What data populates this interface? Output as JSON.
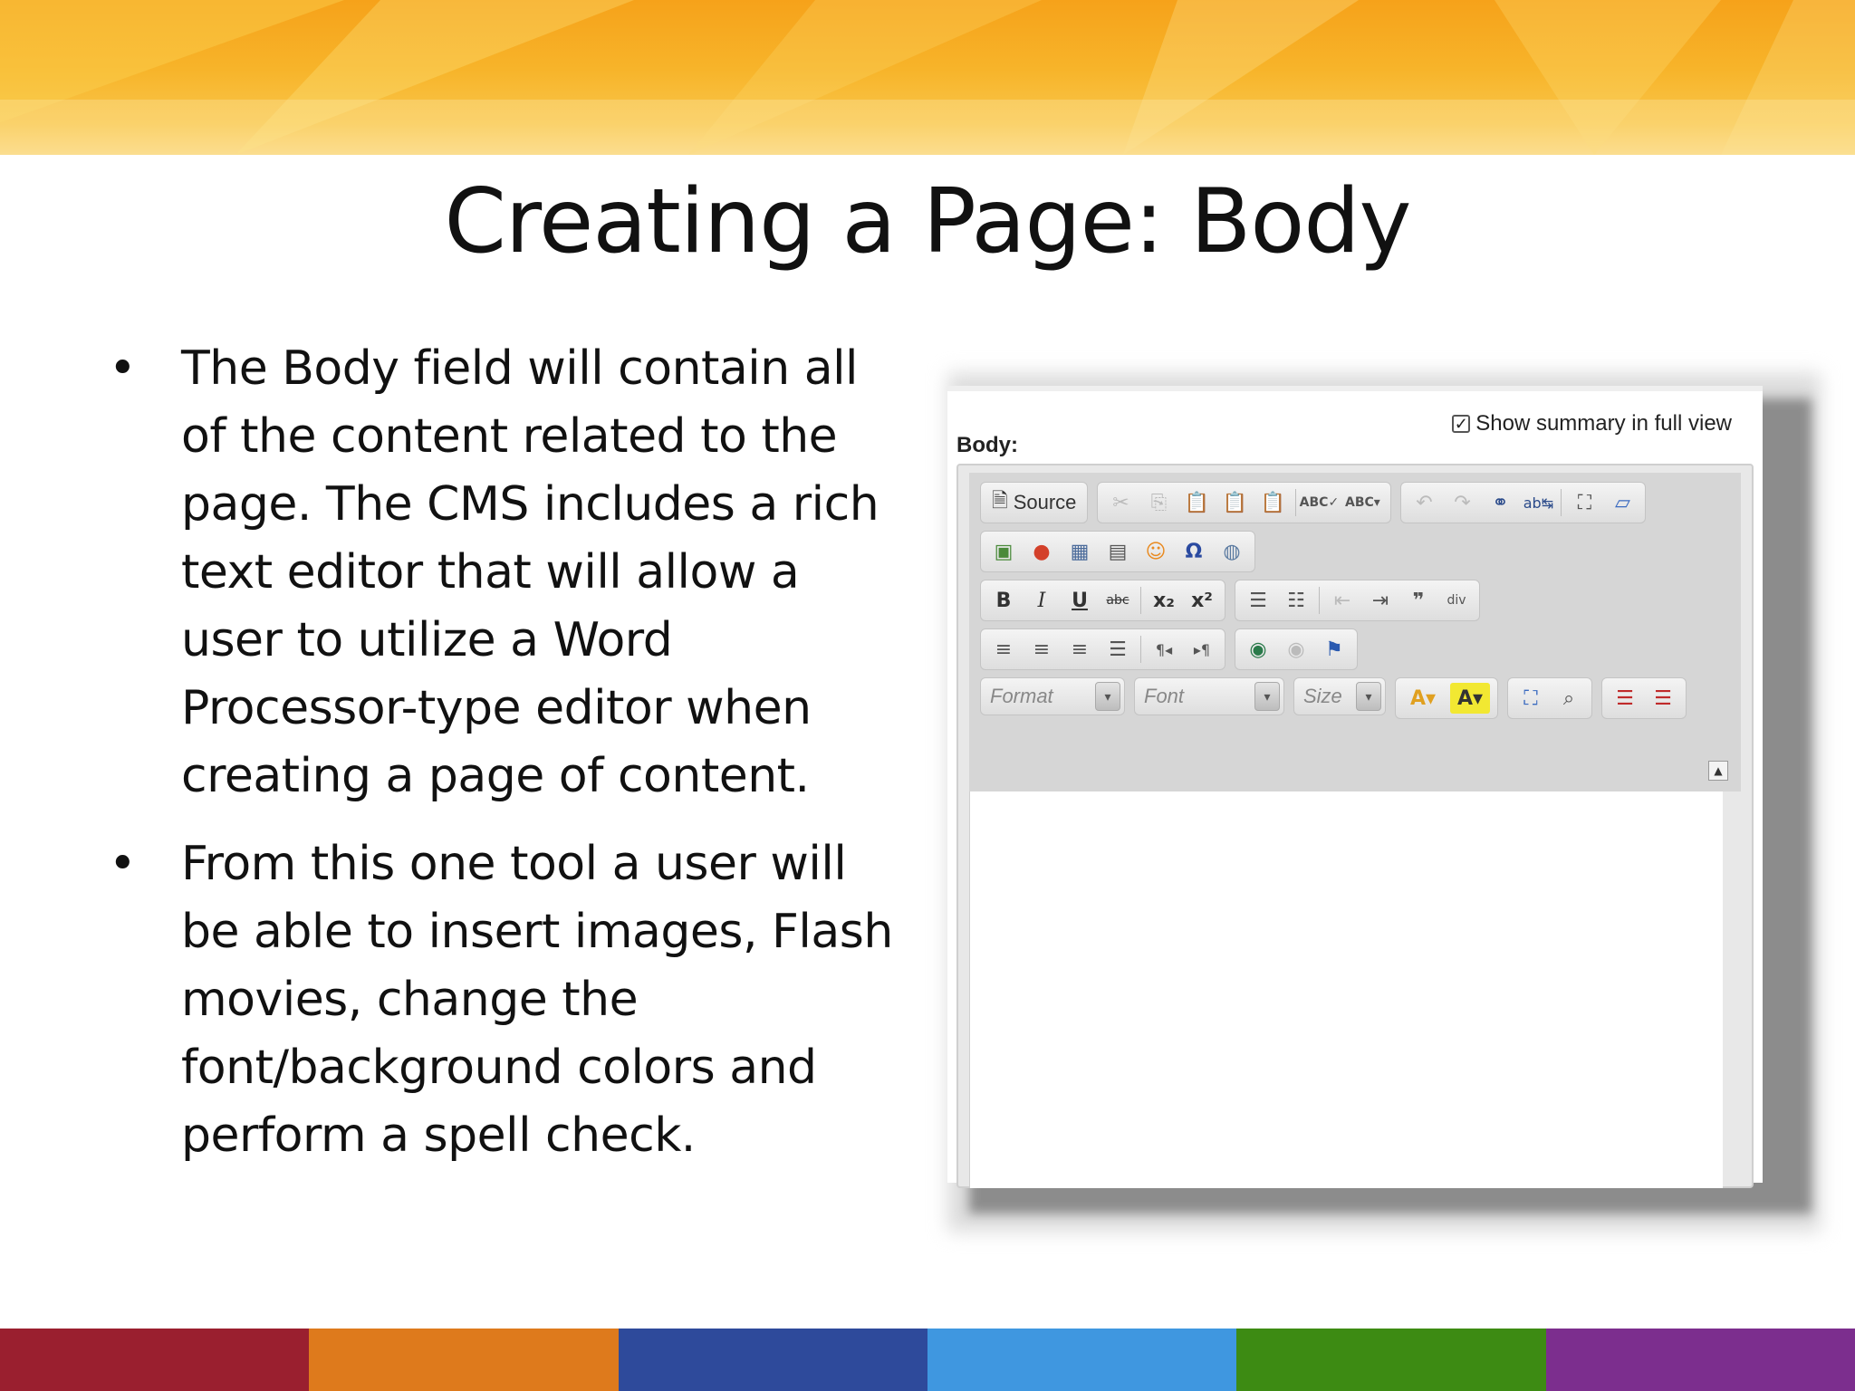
{
  "slide": {
    "title": "Creating a Page: Body",
    "bullets": [
      "The Body field will contain all of the content related to the page. The CMS includes a rich text editor that will allow a user to utilize a Word Processor-type editor when creating a page of content.",
      "From this one tool a user will be able to insert images, Flash movies, change the font/background colors and perform a spell check."
    ],
    "bullet_glyph": "•"
  },
  "editor_screenshot": {
    "summary_label": "Show summary in full view",
    "summary_checked": true,
    "body_label": "Body:",
    "toolbar": {
      "source_label": "Source",
      "format_placeholder": "Format",
      "font_placeholder": "Font",
      "size_placeholder": "Size",
      "icons": {
        "source": "document-icon",
        "cut": "scissors-icon",
        "copy": "copy-icon",
        "paste": "paste-icon",
        "paste_text": "paste-text-icon",
        "paste_word": "paste-word-icon",
        "spellcheck": "spellcheck-icon",
        "spellcheck_as_you_type": "spellcheck-menu-icon",
        "undo": "undo-icon",
        "redo": "redo-icon",
        "find": "binoculars-icon",
        "replace": "replace-icon",
        "select_all": "select-all-icon",
        "remove_format": "eraser-icon",
        "image": "image-icon",
        "flash": "flash-icon",
        "table": "table-icon",
        "horizontal_rule": "horizontal-rule-icon",
        "smiley": "smiley-icon",
        "special_char": "omega-icon",
        "iframe": "globe-icon",
        "bold": "B",
        "italic": "I",
        "underline": "U",
        "strike": "abc",
        "subscript": "x₂",
        "superscript": "x²",
        "ordered_list": "numbered-list-icon",
        "bullet_list": "bullet-list-icon",
        "outdent": "outdent-icon",
        "indent": "indent-icon",
        "blockquote": "quote-icon",
        "div": "div-icon",
        "align_left": "align-left-icon",
        "align_center": "align-center-icon",
        "align_right": "align-right-icon",
        "justify": "justify-icon",
        "ltr": "ltr-icon",
        "rtl": "rtl-icon",
        "link": "link-icon",
        "unlink": "unlink-icon",
        "anchor": "flag-icon",
        "text_color": "text-color-icon",
        "bg_color": "background-color-icon",
        "maximize": "maximize-icon",
        "show_blocks": "show-blocks-icon",
        "page_break": "page-break-icon",
        "teaser_break": "teaser-break-icon"
      }
    }
  },
  "colors": {
    "banner_orange": "#f6a21a",
    "footer": [
      "#9a1f2f",
      "#de7a1c",
      "#2e4a9b",
      "#3f97e0",
      "#3d8b13",
      "#7c2e8e"
    ]
  }
}
